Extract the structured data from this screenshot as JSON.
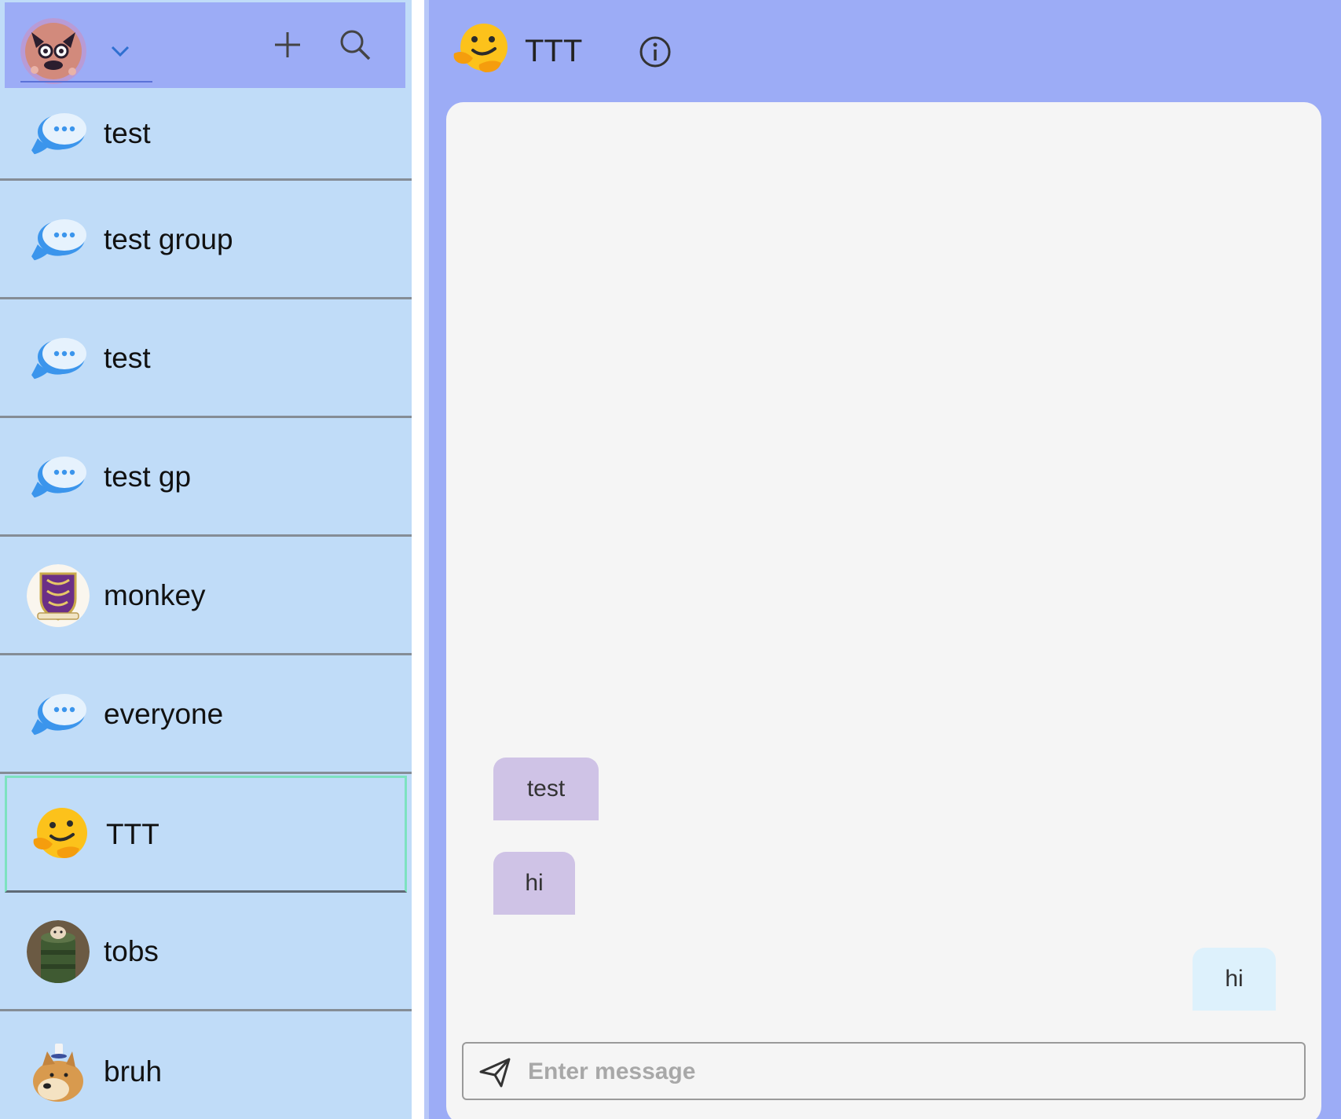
{
  "sidebar": {
    "header": {
      "user_avatar_icon": "fox-avatar-icon",
      "dropdown_icon": "chevron-down-icon",
      "add_icon": "plus-icon",
      "search_icon": "search-icon"
    },
    "chats": [
      {
        "label": "test",
        "avatar": "chat-bubble-icon"
      },
      {
        "label": "test group",
        "avatar": "chat-bubble-icon"
      },
      {
        "label": "test",
        "avatar": "chat-bubble-icon"
      },
      {
        "label": "test gp",
        "avatar": "chat-bubble-icon"
      },
      {
        "label": "monkey",
        "avatar": "crest-avatar"
      },
      {
        "label": "everyone",
        "avatar": "chat-bubble-icon"
      },
      {
        "label": "TTT",
        "avatar": "hugging-face-emoji",
        "selected": true
      },
      {
        "label": "tobs",
        "avatar": "cat-in-can-avatar"
      },
      {
        "label": "bruh",
        "avatar": "doge-avatar"
      }
    ]
  },
  "room": {
    "title": "TTT",
    "avatar": "hugging-face-emoji",
    "info_icon": "info-icon"
  },
  "messages": [
    {
      "text": "test",
      "direction": "incoming"
    },
    {
      "text": "hi",
      "direction": "incoming"
    },
    {
      "text": "hi",
      "direction": "outgoing"
    }
  ],
  "composer": {
    "placeholder": "Enter message",
    "value": "",
    "send_icon": "send-icon"
  },
  "colors": {
    "sidebar_bg": "#c0dcf8",
    "header_bg": "#9cacf6",
    "panel_bg": "#f5f5f5",
    "incoming_bubble": "#cfc3e6",
    "outgoing_bubble": "#ddf1fc",
    "selected_border": "#7de2c0",
    "chat_bubble_icon": "#3b95ec"
  }
}
